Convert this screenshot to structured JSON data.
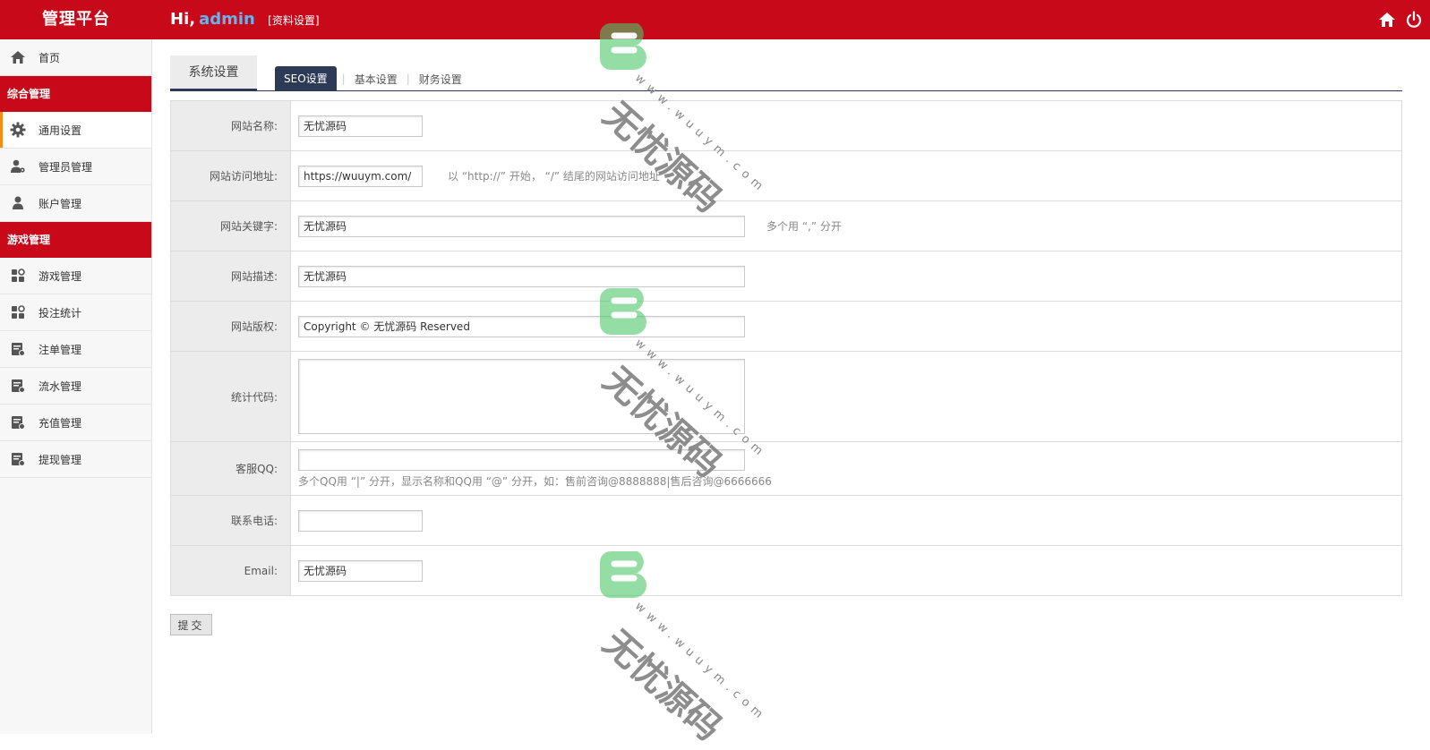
{
  "header": {
    "brand": "管理平台",
    "greeting": "Hi,",
    "username": "admin",
    "profile_link": "[资料设置]",
    "icons": [
      "home-icon",
      "power-icon"
    ]
  },
  "sidebar": {
    "home": {
      "label": "首页",
      "icon": "home-icon"
    },
    "groups": [
      {
        "title": "综合管理",
        "items": [
          {
            "label": "通用设置",
            "icon": "gear-icon",
            "active": true
          },
          {
            "label": "管理员管理",
            "icon": "admin-user-icon"
          },
          {
            "label": "账户管理",
            "icon": "user-icon"
          }
        ]
      },
      {
        "title": "游戏管理",
        "items": [
          {
            "label": "游戏管理",
            "icon": "apps-icon"
          },
          {
            "label": "投注统计",
            "icon": "apps-icon"
          },
          {
            "label": "注单管理",
            "icon": "ledger-icon"
          },
          {
            "label": "流水管理",
            "icon": "ledger-icon"
          },
          {
            "label": "充值管理",
            "icon": "ledger-icon"
          },
          {
            "label": "提现管理",
            "icon": "ledger-icon"
          }
        ]
      }
    ]
  },
  "main": {
    "section_title": "系统设置",
    "tabs": [
      {
        "label": "SEO设置",
        "active": true
      },
      {
        "label": "基本设置"
      },
      {
        "label": "财务设置"
      }
    ],
    "form": {
      "site_name": {
        "label": "网站名称:",
        "value": "无忧源码"
      },
      "site_url": {
        "label": "网站访问地址:",
        "value": "https://wuuym.com/",
        "hint": "以 “http://” 开始，  “/” 结尾的网站访问地址"
      },
      "keywords": {
        "label": "网站关键字:",
        "value": "无忧源码",
        "hint": "多个用 “,” 分开"
      },
      "description": {
        "label": "网站描述:",
        "value": "无忧源码"
      },
      "copyright": {
        "label": "网站版权:",
        "value": "Copyright © 无忧源码 Reserved"
      },
      "stats_code": {
        "label": "统计代码:",
        "value": ""
      },
      "service_qq": {
        "label": "客服QQ:",
        "value": "",
        "hint": "多个QQ用 “|” 分开，显示名称和QQ用 “@” 分开，如：售前咨询@8888888|售后咨询@6666666"
      },
      "phone": {
        "label": "联系电话:",
        "value": ""
      },
      "email": {
        "label": "Email:",
        "value": "无忧源码"
      }
    },
    "submit_label": "提交"
  },
  "watermark": {
    "text": "无忧源码",
    "url": "www.wuuym.com",
    "logo_color": "#4cc86a"
  },
  "colors": {
    "header_red": "#c8091a",
    "nav_navy": "#2d3a56",
    "active_accent": "#f58b15",
    "username_blue": "#5fb6f2"
  }
}
